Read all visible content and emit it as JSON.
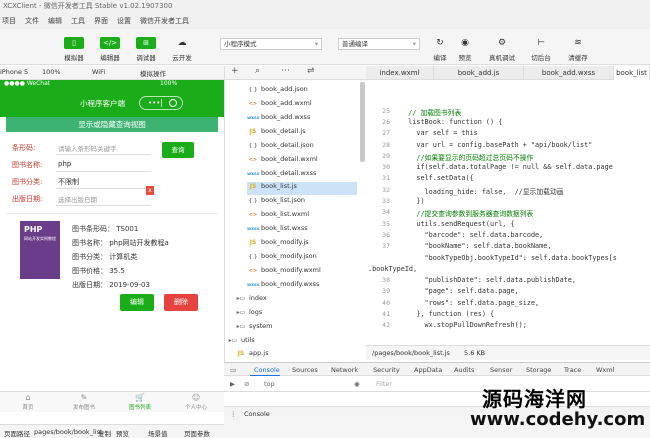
{
  "window_title": "XCXClient - 微信开发者工具 Stable v1.02.1907300",
  "menu": [
    "项目",
    "文件",
    "编辑",
    "工具",
    "界面",
    "设置",
    "微信开发者工具"
  ],
  "toolbar": {
    "simulator": "模拟器",
    "editor": "编辑器",
    "debugger": "调试器",
    "cloud": "云开发",
    "mode_select": "小程序模式",
    "compile_select": "普通编译",
    "compile": "编译",
    "preview": "预览",
    "real_debug": "真机调试",
    "backend": "切后台",
    "clear_cache": "清缓存"
  },
  "sim_bar": {
    "device": "iPhone 5",
    "zoom": "100%",
    "network": "WiFi",
    "ops": "模拟操作"
  },
  "phone": {
    "status_left": "●●●● WeChat",
    "status_right": "100%",
    "nav_title": "小程序客户端",
    "capsule_dots": "•••",
    "banner": "显示或隐藏查询视图",
    "form": {
      "barcode_label": "条形码:",
      "barcode_placeholder": "请输入条形码关键字",
      "query_button": "查询",
      "bookname_label": "图书名称:",
      "bookname_value": "php",
      "booktype_label": "图书分类:",
      "booktype_value": "不限制",
      "date_label": "出版日期:",
      "date_placeholder": "选择出版日期",
      "close_mark": "x"
    },
    "book": {
      "cover_title": "PHP",
      "cover_subtitle": "网站开发实例教程",
      "barcode": "图书条形码： TS001",
      "name": "图书名称： php网站开发教程a",
      "type": "图书分类： 计算机类",
      "price": "图书价格： 35.5",
      "date": "出版日期： 2019-09-03",
      "edit": "编辑",
      "delete": "删除"
    },
    "tabs": [
      {
        "icon": "⌂",
        "label": "首页"
      },
      {
        "icon": "✎",
        "label": "发布图书"
      },
      {
        "icon": "🛒",
        "label": "图书列表"
      },
      {
        "icon": "☺",
        "label": "个人中心"
      }
    ]
  },
  "path_bar": {
    "label": "页面路径",
    "path": "pages/book/book_list",
    "copy": "复制",
    "preview": "预览",
    "scene": "场景值",
    "params": "页面参数"
  },
  "tree": {
    "files": [
      {
        "type": "json",
        "icon": "{ }",
        "name": "book_add.json"
      },
      {
        "type": "wxml",
        "icon": "<>",
        "name": "book_add.wxml"
      },
      {
        "type": "wxss",
        "icon": "wxss",
        "name": "book_add.wxss"
      },
      {
        "type": "js",
        "icon": "JS",
        "name": "book_detail.js"
      },
      {
        "type": "json",
        "icon": "{ }",
        "name": "book_detail.json"
      },
      {
        "type": "wxml",
        "icon": "<>",
        "name": "book_detail.wxml"
      },
      {
        "type": "wxss",
        "icon": "wxss",
        "name": "book_detail.wxss"
      },
      {
        "type": "js",
        "icon": "JS",
        "name": "book_list.js"
      },
      {
        "type": "json",
        "icon": "{ }",
        "name": "book_list.json"
      },
      {
        "type": "wxml",
        "icon": "<>",
        "name": "book_list.wxml"
      },
      {
        "type": "wxss",
        "icon": "wxss",
        "name": "book_list.wxss"
      },
      {
        "type": "js",
        "icon": "JS",
        "name": "book_modify.js"
      },
      {
        "type": "json",
        "icon": "{ }",
        "name": "book_modify.json"
      },
      {
        "type": "wxml",
        "icon": "<>",
        "name": "book_modify.wxml"
      },
      {
        "type": "wxss",
        "icon": "wxss",
        "name": "book_modify.wxss"
      }
    ],
    "folders": [
      "index",
      "logs",
      "system",
      "utils"
    ],
    "last_file": "app.js"
  },
  "editor": {
    "tabs": [
      "index.wxml",
      "book_add.js",
      "book_add.wxss",
      "book_list"
    ],
    "lines": [
      {
        "n": "",
        "t": ""
      },
      {
        "n": "",
        "t": ""
      },
      {
        "n": "25",
        "t": "  // 加载图书列表"
      },
      {
        "n": "26",
        "t": "  listBook: function () {"
      },
      {
        "n": "27",
        "t": "    var self = this"
      },
      {
        "n": "28",
        "t": "    var url = config.basePath + \"api/book/list\""
      },
      {
        "n": "29",
        "t": "    //如果要显示的页码超过总页码不操作"
      },
      {
        "n": "30",
        "t": "    if(self.data.totalPage != null && self.data.page"
      },
      {
        "n": "31",
        "t": "    self.setData({"
      },
      {
        "n": "32",
        "t": "      loading_hide: false,  //显示加载动画"
      },
      {
        "n": "33",
        "t": "    })"
      },
      {
        "n": "34",
        "t": "    //提交查询参数到服务器查询数据列表"
      },
      {
        "n": "35",
        "t": "    utils.sendRequest(url, {"
      },
      {
        "n": "36",
        "t": "      \"barcode\": self.data.barcode,"
      },
      {
        "n": "37",
        "t": "      \"bookName\": self.data.bookName,"
      },
      {
        "n": "",
        "t": "      \"bookTypeObj.bookTypeId\": self.data.bookTypes[s"
      },
      {
        "n": "",
        "t": ".bookTypeId,"
      },
      {
        "n": "38",
        "t": "      \"publishDate\": self.data.publishDate,"
      },
      {
        "n": "39",
        "t": "      \"page\": self.data.page,"
      },
      {
        "n": "40",
        "t": "      \"rows\": self.data.page_size,"
      },
      {
        "n": "41",
        "t": "    }, function (res) {"
      },
      {
        "n": "42",
        "t": "      wx.stopPullDownRefresh();"
      }
    ],
    "status_path": "/pages/book/book_list.js",
    "status_size": "5.6 KB"
  },
  "devtools": {
    "tabs": [
      "Console",
      "Sources",
      "Network",
      "Security",
      "AppData",
      "Audits",
      "Sensor",
      "Storage",
      "Trace",
      "Wxml"
    ],
    "context": "top",
    "filter_placeholder": "Filter",
    "drawer_tab": "Console"
  },
  "watermark": {
    "line1": "源码海洋网",
    "line2": "www.codehy.com"
  }
}
